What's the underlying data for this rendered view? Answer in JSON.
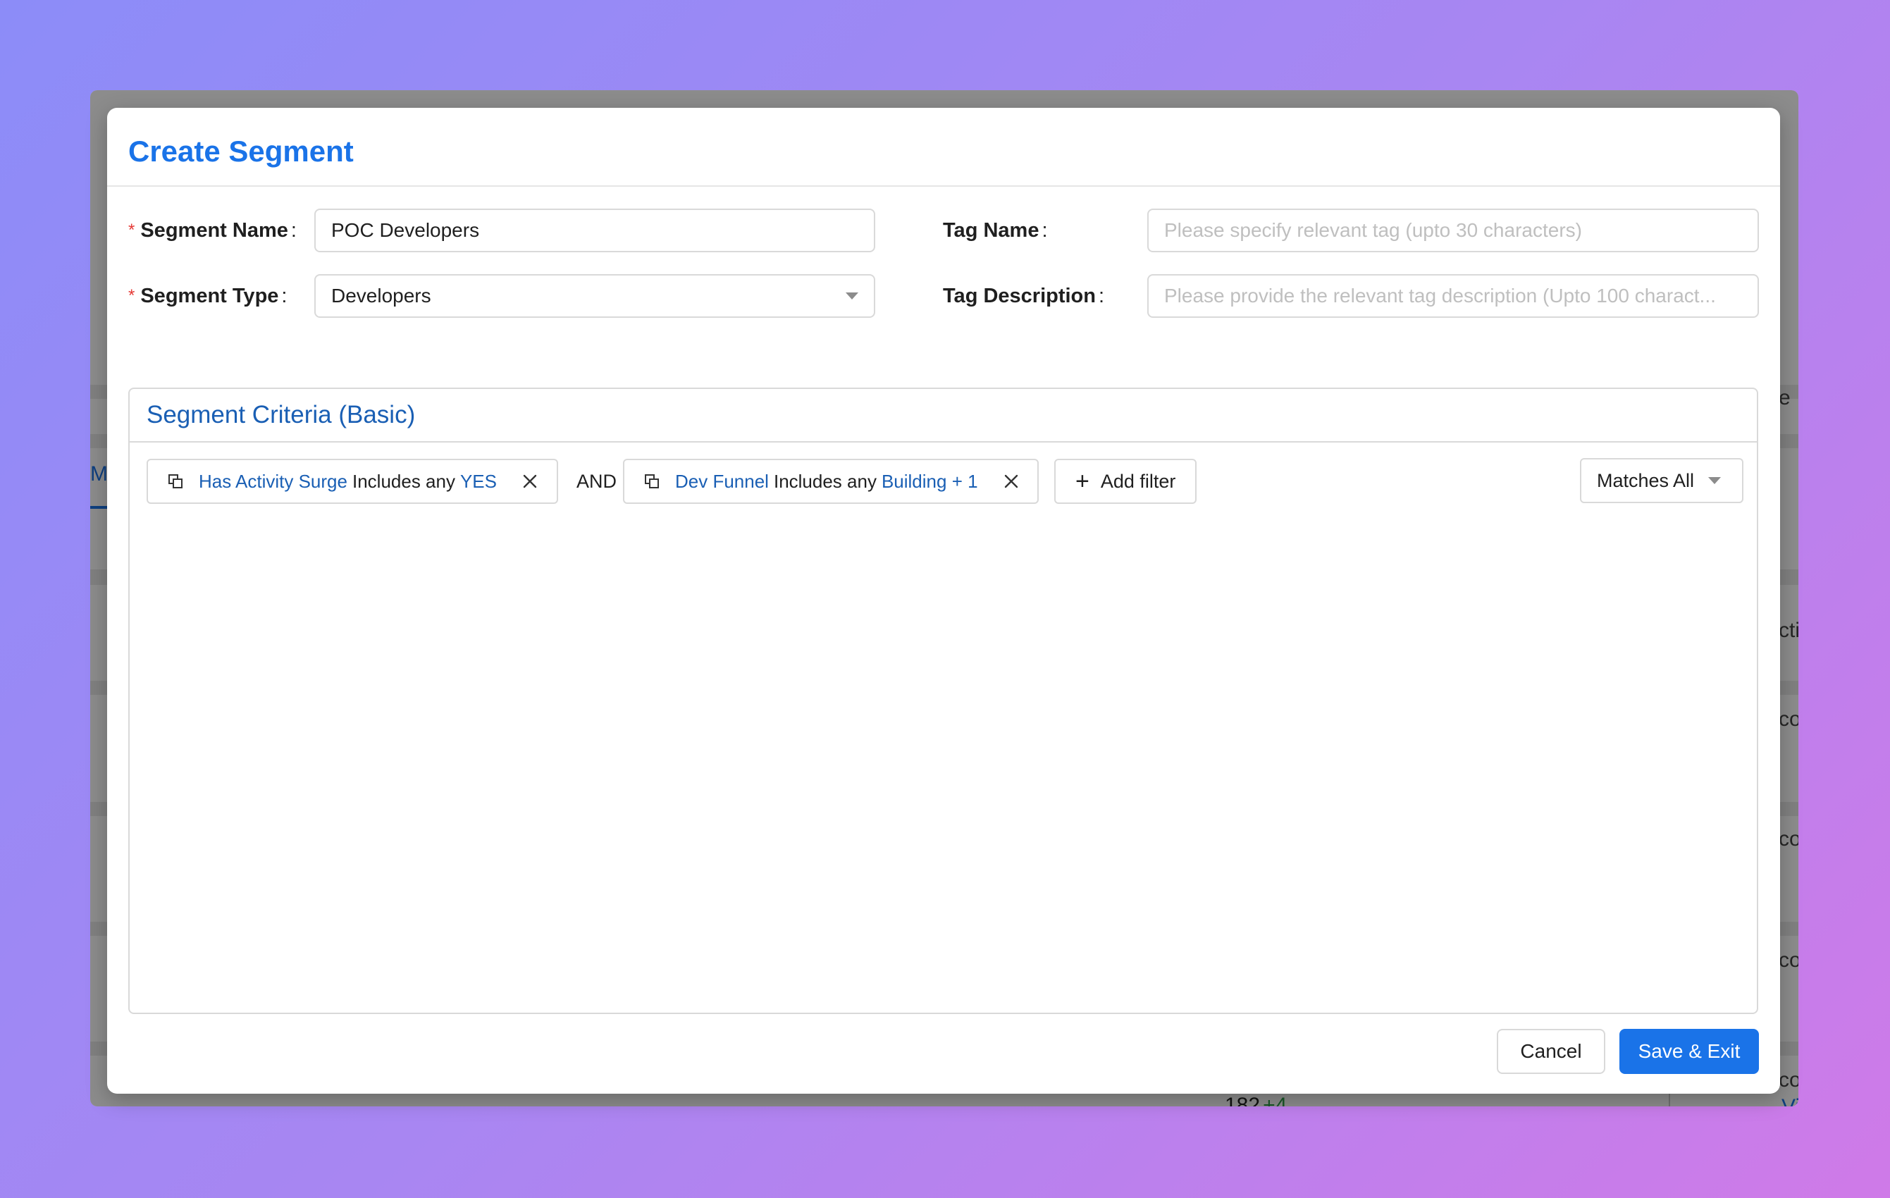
{
  "background_app": {
    "tab_fragment": "M",
    "right_fragments": [
      "e",
      "cti",
      "co",
      "co",
      "co",
      "co"
    ],
    "count_fragment": "182",
    "count_delta": "+4",
    "view_fragment": "View"
  },
  "modal": {
    "title": "Create Segment",
    "segment_name": {
      "label": "Segment Name",
      "required_mark": "*",
      "value": "POC Developers"
    },
    "segment_type": {
      "label": "Segment Type",
      "required_mark": "*",
      "value": "Developers"
    },
    "tag_name": {
      "label": "Tag Name",
      "placeholder": "Please specify relevant tag (upto 30 characters)"
    },
    "tag_description": {
      "label": "Tag Description",
      "placeholder": "Please provide the relevant tag description (Upto 100 charact..."
    },
    "criteria": {
      "title": "Segment Criteria (Basic)",
      "filters": [
        {
          "field": "Has Activity Surge",
          "operator": "Includes any",
          "value": "YES"
        },
        {
          "field": "Dev Funnel",
          "operator": "Includes any",
          "value": "Building + 1"
        }
      ],
      "conjunction": "AND",
      "add_filter_label": "Add filter",
      "match_mode": "Matches All"
    },
    "cancel_label": "Cancel",
    "save_label": "Save & Exit"
  },
  "colors": {
    "accent": "#1a73e8",
    "link_blue": "#1a5fb4",
    "required": "#e53935"
  }
}
